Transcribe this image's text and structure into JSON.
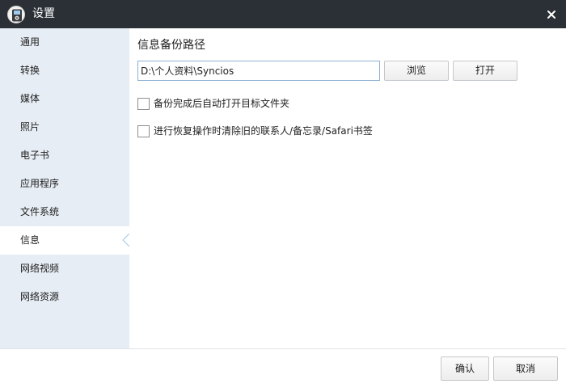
{
  "window": {
    "title": "设置",
    "icon": "ipod-app-icon",
    "close_icon": "close-icon"
  },
  "sidebar": {
    "items": [
      {
        "label": "通用",
        "active": false
      },
      {
        "label": "转换",
        "active": false
      },
      {
        "label": "媒体",
        "active": false
      },
      {
        "label": "照片",
        "active": false
      },
      {
        "label": "电子书",
        "active": false
      },
      {
        "label": "应用程序",
        "active": false
      },
      {
        "label": "文件系统",
        "active": false
      },
      {
        "label": "信息",
        "active": true
      },
      {
        "label": "网络视频",
        "active": false
      },
      {
        "label": "网络资源",
        "active": false
      }
    ]
  },
  "main": {
    "section_title": "信息备份路径",
    "path_value": "D:\\个人资料\\Syncios",
    "browse_label": "浏览",
    "open_label": "打开",
    "options": [
      {
        "label": "备份完成后自动打开目标文件夹",
        "checked": false
      },
      {
        "label": "进行恢复操作时清除旧的联系人/备忘录/Safari书签",
        "checked": false
      }
    ]
  },
  "footer": {
    "ok_label": "确认",
    "cancel_label": "取消"
  },
  "colors": {
    "titlebar": "#2b3036",
    "sidebar": "#e6edf4",
    "active_item": "#ffffff",
    "input_border": "#8fb1d3"
  }
}
